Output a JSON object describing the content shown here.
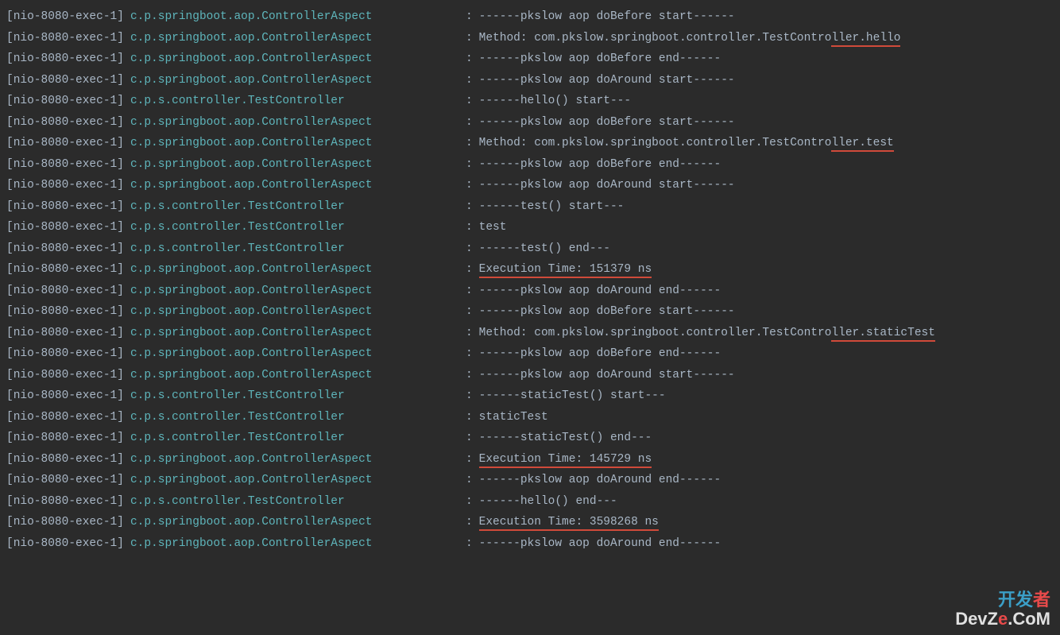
{
  "thread": "[nio-8080-exec-1]",
  "loggers": {
    "aspect": "c.p.springboot.aop.ControllerAspect",
    "controller": "c.p.s.controller.TestController"
  },
  "lines": [
    {
      "logger": "aspect",
      "msg": "------pkslow aop doBefore start------",
      "underline": null
    },
    {
      "logger": "aspect",
      "msg_prefix": "Method: com.pkslow.springboot.controller.TestContro",
      "msg_underline": "ller.hello",
      "underline": "end"
    },
    {
      "logger": "aspect",
      "msg": "------pkslow aop doBefore end------",
      "underline": null
    },
    {
      "logger": "aspect",
      "msg": "------pkslow aop doAround start------",
      "underline": null
    },
    {
      "logger": "controller",
      "msg": "------hello() start---",
      "underline": null
    },
    {
      "logger": "aspect",
      "msg": "------pkslow aop doBefore start------",
      "underline": null
    },
    {
      "logger": "aspect",
      "msg_prefix": "Method: com.pkslow.springboot.controller.TestContro",
      "msg_underline": "ller.test",
      "underline": "end"
    },
    {
      "logger": "aspect",
      "msg": "------pkslow aop doBefore end------",
      "underline": null
    },
    {
      "logger": "aspect",
      "msg": "------pkslow aop doAround start------",
      "underline": null
    },
    {
      "logger": "controller",
      "msg": "------test() start---",
      "underline": null
    },
    {
      "logger": "controller",
      "msg": "test",
      "underline": null
    },
    {
      "logger": "controller",
      "msg": "------test() end---",
      "underline": null
    },
    {
      "logger": "aspect",
      "msg_underline": "Execution Time: 151379 ns",
      "underline": "full"
    },
    {
      "logger": "aspect",
      "msg": "------pkslow aop doAround end------",
      "underline": null
    },
    {
      "logger": "aspect",
      "msg": "------pkslow aop doBefore start------",
      "underline": null
    },
    {
      "logger": "aspect",
      "msg_prefix": "Method: com.pkslow.springboot.controller.TestContro",
      "msg_underline": "ller.staticTest",
      "underline": "end"
    },
    {
      "logger": "aspect",
      "msg": "------pkslow aop doBefore end------",
      "underline": null
    },
    {
      "logger": "aspect",
      "msg": "------pkslow aop doAround start------",
      "underline": null
    },
    {
      "logger": "controller",
      "msg": "------staticTest() start---",
      "underline": null
    },
    {
      "logger": "controller",
      "msg": "staticTest",
      "underline": null
    },
    {
      "logger": "controller",
      "msg": "------staticTest() end---",
      "underline": null
    },
    {
      "logger": "aspect",
      "msg_underline": "Execution Time: 145729 ns",
      "underline": "full"
    },
    {
      "logger": "aspect",
      "msg": "------pkslow aop doAround end------",
      "underline": null
    },
    {
      "logger": "controller",
      "msg": "------hello() end---",
      "underline": null
    },
    {
      "logger": "aspect",
      "msg_underline": "Execution Time: 3598268 ns",
      "underline": "full"
    },
    {
      "logger": "aspect",
      "msg": "------pkslow aop doAround end------",
      "underline": null
    }
  ],
  "watermark": {
    "top_text_1": "开发",
    "top_text_red": "者",
    "bot_text_1": "DevZ",
    "bot_text_red": "e",
    "bot_text_2": ".CoM"
  }
}
